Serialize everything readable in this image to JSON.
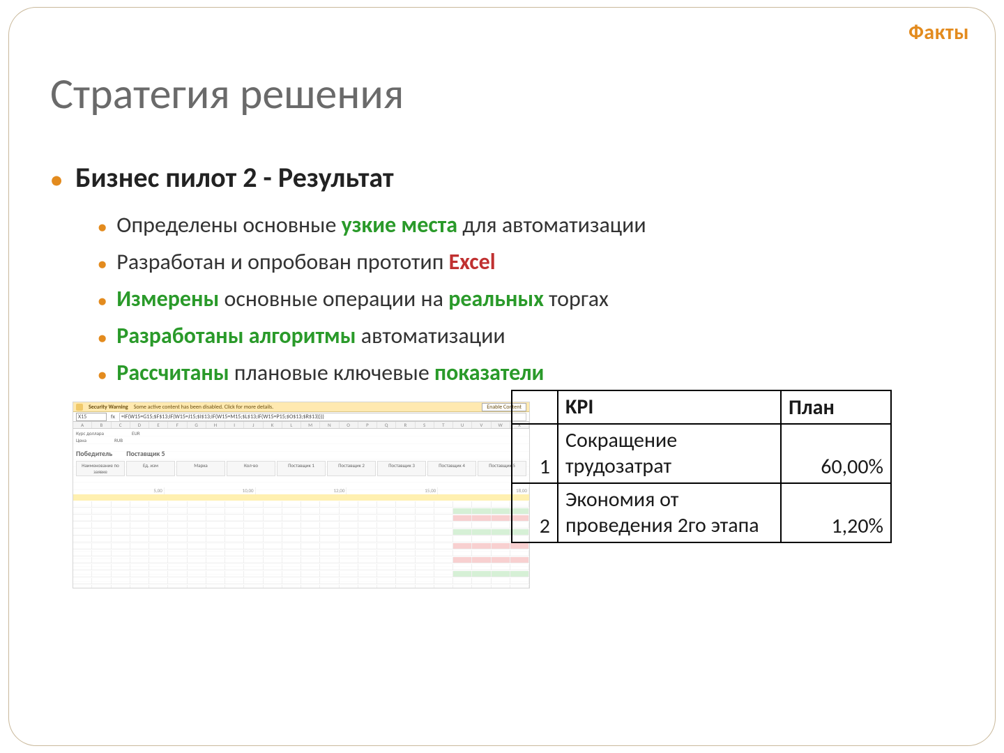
{
  "badge": "Факты",
  "title": "Стратегия решения",
  "bullet1": "Бизнес пилот 2 - Результат",
  "sub": [
    {
      "pre": "Определены основные ",
      "hl1": "узкие места",
      "mid": " для автоматизации",
      "hl1cls": "g"
    },
    {
      "pre": "Разработан и опробован прототип ",
      "hl1": "Excel",
      "mid": "",
      "hl1cls": "r"
    },
    {
      "pre": "",
      "hl1": "Измерены",
      "mid": " основные операции на ",
      "hl2": "реальных",
      "post": " торгах",
      "hl1cls": "g",
      "hl2cls": "g"
    },
    {
      "pre": "",
      "hl1": "Разработаны алгоритмы",
      "mid": " автоматизации",
      "hl1cls": "g"
    },
    {
      "pre": "",
      "hl1": "Рассчитаны",
      "mid": " плановые ключевые ",
      "hl2": "показатели",
      "post": "",
      "hl1cls": "g",
      "hl2cls": "g"
    }
  ],
  "excel": {
    "warn_bold": "Security Warning",
    "warn_text": "Some active content has been disabled. Click for more details.",
    "warn_btn": "Enable Content",
    "cellref": "X15",
    "fx_label": "fx",
    "formula": "=IF(W15=G15;$F$13;IF(W15=J15;$I$13;IF(W15=M15;$L$13;IF(W15=P15;$O$13;$R$13))))",
    "cols": [
      "A",
      "B",
      "C",
      "D",
      "E",
      "F",
      "G",
      "H",
      "I",
      "J",
      "K",
      "L",
      "M",
      "N",
      "O",
      "P",
      "Q",
      "R",
      "S",
      "T",
      "U",
      "V",
      "W",
      "X"
    ],
    "top_labels": [
      "Курс доллара",
      "Цена",
      "EUR",
      "RUB"
    ],
    "winner_label": "Победитель",
    "winner_value": "Поставщик 5",
    "ruler": [
      "5,00",
      "10,00",
      "12,00",
      "15,00",
      "18,00"
    ],
    "segments": [
      "Наименование по заявке",
      "Ед. изм",
      "Марка",
      "Кол-во",
      "Поставщик 1",
      "Поставщик 2",
      "Поставщик 3",
      "Поставщик 4",
      "Поставщик 5"
    ]
  },
  "kpi": {
    "h1": "KPI",
    "h2": "План",
    "rows": [
      {
        "n": "1",
        "desc": "Сокращение трудозатрат",
        "val": "60,00%"
      },
      {
        "n": "2",
        "desc": "Экономия от проведения 2го этапа",
        "val": "1,20%"
      }
    ]
  }
}
